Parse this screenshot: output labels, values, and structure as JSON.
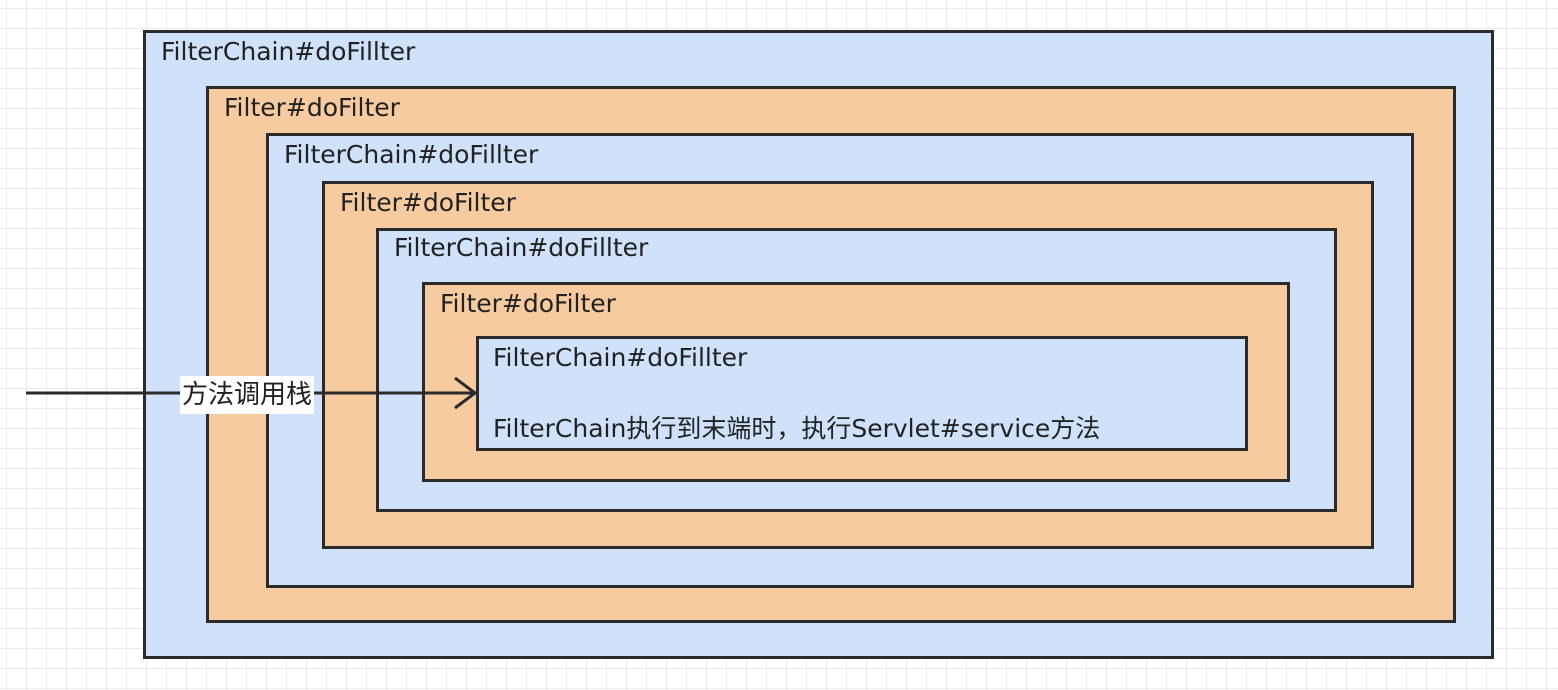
{
  "boxes": [
    {
      "label": "FilterChain#doFillter",
      "fill": "#cfe2fa"
    },
    {
      "label": "Filter#doFilter",
      "fill": "#f6cba0"
    },
    {
      "label": "FilterChain#doFillter",
      "fill": "#cfe2fa"
    },
    {
      "label": "Filter#doFilter",
      "fill": "#f6cba0"
    },
    {
      "label": "FilterChain#doFillter",
      "fill": "#cfe2fa"
    },
    {
      "label": "Filter#doFilter",
      "fill": "#f6cba0"
    },
    {
      "label": "FilterChain#doFillter",
      "fill": "#cfe2fa"
    }
  ],
  "innermost_note": "FilterChain执行到末端时，执行Servlet#service方法",
  "arrow_label": "方法调用栈",
  "colors": {
    "chain_fill": "#cfe2fa",
    "filter_fill": "#f6cba0",
    "border": "#2b2b2b",
    "grid": "#ebebeb"
  }
}
